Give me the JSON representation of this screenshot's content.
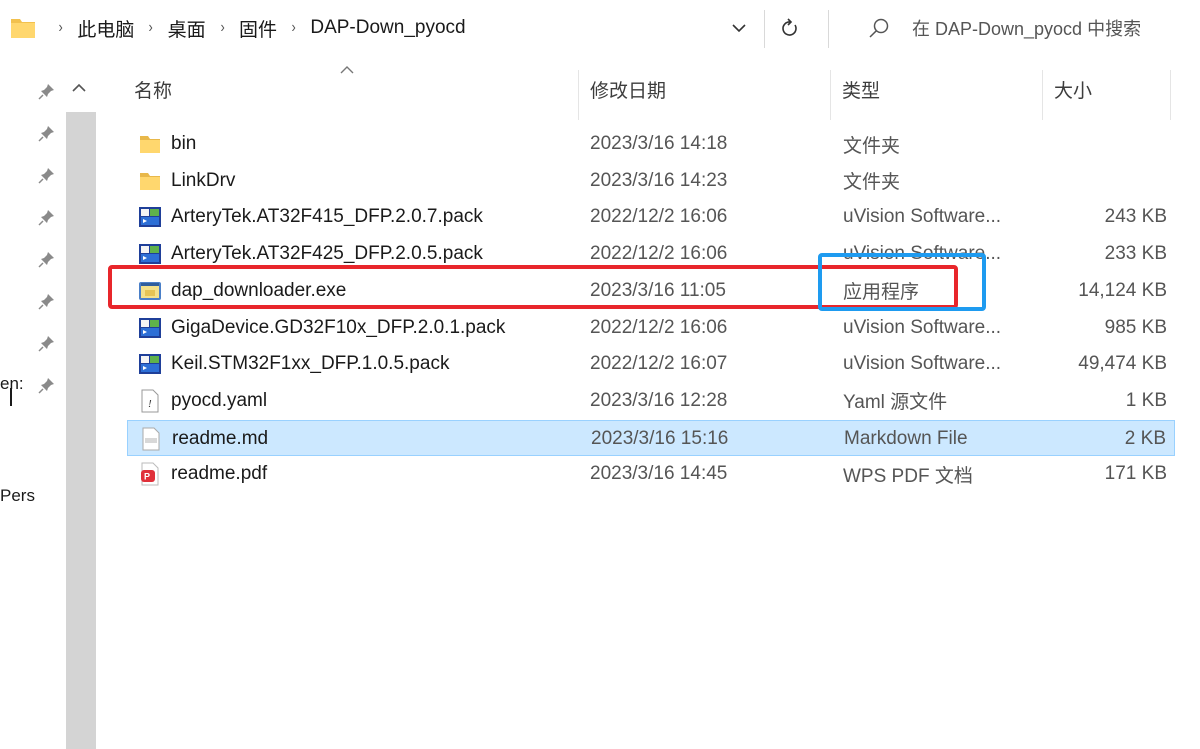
{
  "breadcrumb": {
    "items": [
      "此电脑",
      "桌面",
      "固件",
      "DAP-Down_pyocd"
    ],
    "separator": "›"
  },
  "search": {
    "placeholder": "在 DAP-Down_pyocd 中搜索"
  },
  "nav": {
    "fragments": [
      "en:",
      "Pers"
    ]
  },
  "columns": {
    "name": "名称",
    "date": "修改日期",
    "type": "类型",
    "size": "大小"
  },
  "files": [
    {
      "name": "bin",
      "date": "2023/3/16 14:18",
      "type": "文件夹",
      "size": "",
      "icon": "folder-icon"
    },
    {
      "name": "LinkDrv",
      "date": "2023/3/16 14:23",
      "type": "文件夹",
      "size": "",
      "icon": "folder-icon"
    },
    {
      "name": "ArteryTek.AT32F415_DFP.2.0.7.pack",
      "date": "2022/12/2 16:06",
      "type": "uVision Software...",
      "size": "243 KB",
      "icon": "uvision-pack-icon"
    },
    {
      "name": "ArteryTek.AT32F425_DFP.2.0.5.pack",
      "date": "2022/12/2 16:06",
      "type": "uVision Software...",
      "size": "233 KB",
      "icon": "uvision-pack-icon"
    },
    {
      "name": "dap_downloader.exe",
      "date": "2023/3/16 11:05",
      "type": "应用程序",
      "size": "14,124 KB",
      "icon": "exe-icon"
    },
    {
      "name": "GigaDevice.GD32F10x_DFP.2.0.1.pack",
      "date": "2022/12/2 16:06",
      "type": "uVision Software...",
      "size": "985 KB",
      "icon": "uvision-pack-icon"
    },
    {
      "name": "Keil.STM32F1xx_DFP.1.0.5.pack",
      "date": "2022/12/2 16:07",
      "type": "uVision Software...",
      "size": "49,474 KB",
      "icon": "uvision-pack-icon"
    },
    {
      "name": "pyocd.yaml",
      "date": "2023/3/16 12:28",
      "type": "Yaml 源文件",
      "size": "1 KB",
      "icon": "yaml-file-icon"
    },
    {
      "name": "readme.md",
      "date": "2023/3/16 15:16",
      "type": "Markdown File",
      "size": "2 KB",
      "icon": "markdown-file-icon",
      "selected": true
    },
    {
      "name": "readme.pdf",
      "date": "2023/3/16 14:45",
      "type": "WPS PDF 文档",
      "size": "171 KB",
      "icon": "pdf-icon"
    }
  ],
  "annotations": {
    "red": "#e8262b",
    "blue": "#1e9bf0",
    "selection": "#cce8ff"
  }
}
